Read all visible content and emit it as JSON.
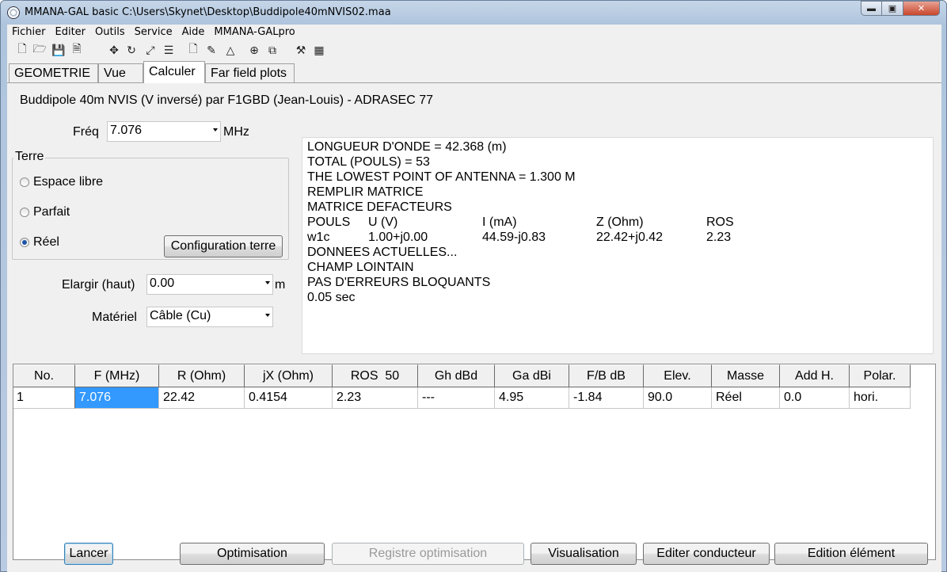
{
  "window": {
    "title": "MMANA-GAL basic C:\\Users\\Skynet\\Desktop\\Buddipole40mNVIS02.maa",
    "min_label": "▬",
    "max_label": "▣",
    "close_label": "✕"
  },
  "menu": [
    "Fichier",
    "Editer",
    "Outils",
    "Service",
    "Aide",
    "MMANA-GALpro"
  ],
  "toolbar": {
    "icons": [
      "new-file-icon",
      "open-folder-icon",
      "save-disk-icon",
      "info-doc-icon",
      "move-arrows-icon",
      "rotate-icon",
      "stretch-icon",
      "wire-list-icon",
      "page-icon",
      "draw-icon",
      "triangle-icon",
      "crosshair-icon",
      "copy-icon",
      "tools-icon",
      "calculator-icon"
    ],
    "glyphs": [
      "🗋",
      "🗁",
      "💾",
      "🗎",
      "✥",
      "↻",
      "⤢",
      "☰",
      "🗋",
      "✎",
      "△",
      "⊕",
      "⧉",
      "⚒",
      "▦"
    ]
  },
  "tabs": [
    "GEOMETRIE",
    "Vue",
    "Calculer",
    "Far field plots"
  ],
  "active_tab": "Calculer",
  "calc": {
    "description": "Buddipole 40m NVIS (V inversé) par F1GBD (Jean-Louis) - ADRASEC 77",
    "freq_label": "Fréq",
    "freq_value": "7.076",
    "freq_unit": "MHz",
    "ground_group": "Terre",
    "ground_options": [
      "Espace libre",
      "Parfait",
      "Réel"
    ],
    "ground_selected": "Réel",
    "ground_config_button": "Configuration terre",
    "widen_label": "Elargir (haut)",
    "widen_value": "0.00",
    "widen_unit": "m",
    "material_label": "Matériel",
    "material_value": "Câble (Cu)"
  },
  "output": {
    "lines": [
      "LONGUEUR D'ONDE = 42.368 (m)",
      "TOTAL (POULS) = 53",
      "THE LOWEST POINT OF ANTENNA = 1.300 M",
      "REMPLIR MATRICE",
      "MATRICE DEFACTEURS"
    ],
    "table_header": [
      "POULS",
      "U (V)",
      "I (mA)",
      "Z (Ohm)",
      "ROS"
    ],
    "table_row": [
      "w1c",
      "1.00+j0.00",
      "44.59-j0.83",
      "22.42+j0.42",
      "2.23"
    ],
    "lines_after": [
      "DONNEES ACTUELLES...",
      "CHAMP LOINTAIN",
      "PAS D'ERREURS BLOQUANTS",
      "0.05 sec"
    ]
  },
  "results": {
    "columns": [
      "No.",
      "F (MHz)",
      "R (Ohm)",
      "jX (Ohm)",
      "ROS  50",
      "Gh dBd",
      "Ga dBi",
      "F/B dB",
      "Elev.",
      "Masse",
      "Add H.",
      "Polar."
    ],
    "rows": [
      [
        "1",
        "7.076",
        "22.42",
        "0.4154",
        "2.23",
        "---",
        "4.95",
        "-1.84",
        "90.0",
        "Réel",
        "0.0",
        "hori."
      ]
    ]
  },
  "buttons": {
    "run": "Lancer",
    "optimize": "Optimisation",
    "opt_log": "Registre optimisation",
    "view": "Visualisation",
    "edit_wire": "Editer conducteur",
    "edit_element": "Edition élément"
  }
}
